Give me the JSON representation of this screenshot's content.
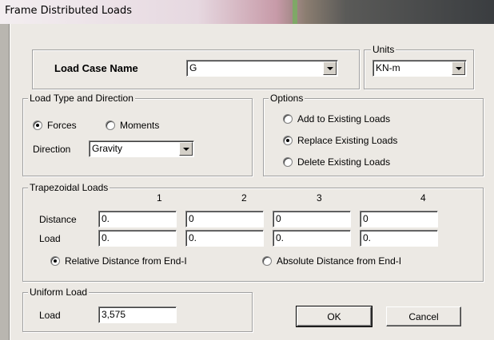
{
  "window": {
    "title": "Frame Distributed Loads"
  },
  "load_case": {
    "label": "Load Case Name",
    "value": "G"
  },
  "units": {
    "legend": "Units",
    "value": "KN-m"
  },
  "load_type": {
    "legend": "Load Type and Direction",
    "forces_label": "Forces",
    "moments_label": "Moments",
    "selected": "Forces",
    "direction_label": "Direction",
    "direction_value": "Gravity"
  },
  "options": {
    "legend": "Options",
    "items": [
      "Add to Existing Loads",
      "Replace Existing Loads",
      "Delete Existing Loads"
    ],
    "selected": "Replace Existing Loads"
  },
  "trapezoidal": {
    "legend": "Trapezoidal Loads",
    "columns": [
      "1",
      "2",
      "3",
      "4"
    ],
    "distance_label": "Distance",
    "load_label": "Load",
    "distance_values": [
      "0.",
      "0",
      "0",
      "0"
    ],
    "load_values": [
      "0.",
      "0.",
      "0.",
      "0."
    ],
    "relative_label": "Relative Distance from End-I",
    "absolute_label": "Absolute Distance from End-I",
    "selected": "Relative Distance from End-I"
  },
  "uniform": {
    "legend": "Uniform Load",
    "load_label": "Load",
    "load_value": "3,575"
  },
  "buttons": {
    "ok": "OK",
    "cancel": "Cancel"
  },
  "colors": {
    "dialog_bg": "#ece9e4",
    "border": "#a0a0a0",
    "title_accent": "#c79aa8"
  }
}
